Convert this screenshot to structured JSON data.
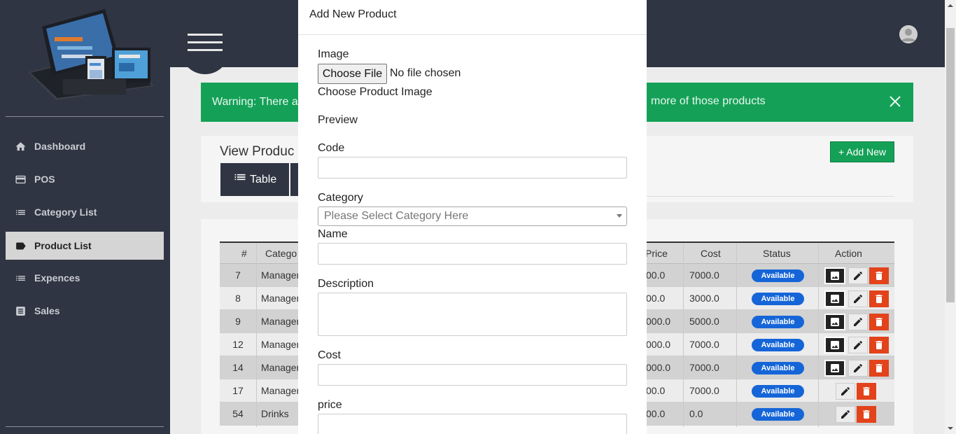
{
  "sidebar": {
    "items": [
      {
        "label": "Dashboard",
        "icon": "home-icon"
      },
      {
        "label": "POS",
        "icon": "card-icon"
      },
      {
        "label": "Category List",
        "icon": "list-icon"
      },
      {
        "label": "Product List",
        "icon": "label-icon",
        "active": true
      },
      {
        "label": "Expences",
        "icon": "list-icon"
      },
      {
        "label": "Sales",
        "icon": "document-icon"
      }
    ]
  },
  "alert": {
    "text_start": "Warning: There ar",
    "text_end": "more of those products"
  },
  "view": {
    "title": "View Produc",
    "tab_table": "Table",
    "add_new": "+ Add New"
  },
  "table": {
    "headers": [
      "#",
      "Catego",
      "Price",
      "Cost",
      "Status",
      "Action"
    ],
    "rows": [
      {
        "id": "7",
        "category": "Manager",
        "price": "00.0",
        "cost": "7000.0",
        "status": "Available",
        "has_image": true
      },
      {
        "id": "8",
        "category": "Manager",
        "price": "00.0",
        "cost": "3000.0",
        "status": "Available",
        "has_image": true
      },
      {
        "id": "9",
        "category": "Manager",
        "price": "000.0",
        "cost": "5000.0",
        "status": "Available",
        "has_image": true
      },
      {
        "id": "12",
        "category": "Manager",
        "price": "000.0",
        "cost": "7000.0",
        "status": "Available",
        "has_image": true
      },
      {
        "id": "14",
        "category": "Manager",
        "price": "000.0",
        "cost": "7000.0",
        "status": "Available",
        "has_image": true
      },
      {
        "id": "17",
        "category": "Manager",
        "price": "00.0",
        "cost": "7000.0",
        "status": "Available",
        "has_image": false
      },
      {
        "id": "54",
        "category": "Drinks",
        "price": "00.0",
        "cost": "0.0",
        "status": "Available",
        "has_image": false
      }
    ]
  },
  "modal": {
    "title": "Add New Product",
    "image_label": "Image",
    "file_button": "Choose File",
    "file_status": "No file chosen",
    "image_help": "Choose Product Image",
    "preview_label": "Preview",
    "code_label": "Code",
    "code_value": "",
    "category_label": "Category",
    "category_placeholder": "Please Select Category Here",
    "name_label": "Name",
    "name_value": "",
    "description_label": "Description",
    "description_value": "",
    "cost_label": "Cost",
    "cost_value": "",
    "price_label": "price",
    "price_value": ""
  },
  "colors": {
    "sidebar_bg": "#2f3542",
    "success_green": "#14a157",
    "badge_blue": "#1565d8",
    "delete_red": "#e2431b"
  }
}
